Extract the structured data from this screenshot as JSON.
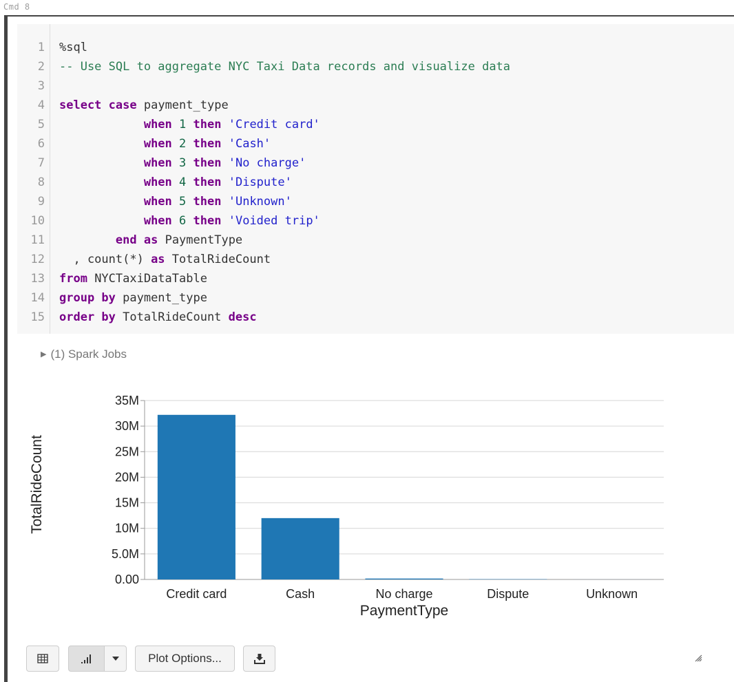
{
  "cell": {
    "cmd_label": "Cmd 8",
    "code_lines": [
      {
        "n": "1",
        "parts": [
          {
            "t": "%sql",
            "c": ""
          }
        ]
      },
      {
        "n": "2",
        "parts": [
          {
            "t": "-- Use SQL to aggregate NYC Taxi Data records and visualize data",
            "c": "cm"
          }
        ]
      },
      {
        "n": "3",
        "parts": []
      },
      {
        "n": "4",
        "parts": [
          {
            "t": "select",
            "c": "kw"
          },
          {
            "t": " ",
            "c": ""
          },
          {
            "t": "case",
            "c": "kw"
          },
          {
            "t": " payment_type",
            "c": ""
          }
        ]
      },
      {
        "n": "5",
        "parts": [
          {
            "t": "            ",
            "c": ""
          },
          {
            "t": "when",
            "c": "kw"
          },
          {
            "t": " ",
            "c": ""
          },
          {
            "t": "1",
            "c": "num"
          },
          {
            "t": " ",
            "c": ""
          },
          {
            "t": "then",
            "c": "kw"
          },
          {
            "t": " ",
            "c": ""
          },
          {
            "t": "'Credit card'",
            "c": "str"
          }
        ]
      },
      {
        "n": "6",
        "parts": [
          {
            "t": "            ",
            "c": ""
          },
          {
            "t": "when",
            "c": "kw"
          },
          {
            "t": " ",
            "c": ""
          },
          {
            "t": "2",
            "c": "num"
          },
          {
            "t": " ",
            "c": ""
          },
          {
            "t": "then",
            "c": "kw"
          },
          {
            "t": " ",
            "c": ""
          },
          {
            "t": "'Cash'",
            "c": "str"
          }
        ]
      },
      {
        "n": "7",
        "parts": [
          {
            "t": "            ",
            "c": ""
          },
          {
            "t": "when",
            "c": "kw"
          },
          {
            "t": " ",
            "c": ""
          },
          {
            "t": "3",
            "c": "num"
          },
          {
            "t": " ",
            "c": ""
          },
          {
            "t": "then",
            "c": "kw"
          },
          {
            "t": " ",
            "c": ""
          },
          {
            "t": "'No charge'",
            "c": "str"
          }
        ]
      },
      {
        "n": "8",
        "parts": [
          {
            "t": "            ",
            "c": ""
          },
          {
            "t": "when",
            "c": "kw"
          },
          {
            "t": " ",
            "c": ""
          },
          {
            "t": "4",
            "c": "num"
          },
          {
            "t": " ",
            "c": ""
          },
          {
            "t": "then",
            "c": "kw"
          },
          {
            "t": " ",
            "c": ""
          },
          {
            "t": "'Dispute'",
            "c": "str"
          }
        ]
      },
      {
        "n": "9",
        "parts": [
          {
            "t": "            ",
            "c": ""
          },
          {
            "t": "when",
            "c": "kw"
          },
          {
            "t": " ",
            "c": ""
          },
          {
            "t": "5",
            "c": "num"
          },
          {
            "t": " ",
            "c": ""
          },
          {
            "t": "then",
            "c": "kw"
          },
          {
            "t": " ",
            "c": ""
          },
          {
            "t": "'Unknown'",
            "c": "str"
          }
        ]
      },
      {
        "n": "10",
        "parts": [
          {
            "t": "            ",
            "c": ""
          },
          {
            "t": "when",
            "c": "kw"
          },
          {
            "t": " ",
            "c": ""
          },
          {
            "t": "6",
            "c": "num"
          },
          {
            "t": " ",
            "c": ""
          },
          {
            "t": "then",
            "c": "kw"
          },
          {
            "t": " ",
            "c": ""
          },
          {
            "t": "'Voided trip'",
            "c": "str"
          }
        ]
      },
      {
        "n": "11",
        "parts": [
          {
            "t": "        ",
            "c": ""
          },
          {
            "t": "end",
            "c": "kw"
          },
          {
            "t": " ",
            "c": ""
          },
          {
            "t": "as",
            "c": "kw"
          },
          {
            "t": " PaymentType",
            "c": ""
          }
        ]
      },
      {
        "n": "12",
        "parts": [
          {
            "t": "  , count(*) ",
            "c": ""
          },
          {
            "t": "as",
            "c": "kw"
          },
          {
            "t": " TotalRideCount",
            "c": ""
          }
        ]
      },
      {
        "n": "13",
        "parts": [
          {
            "t": "from",
            "c": "kw"
          },
          {
            "t": " NYCTaxiDataTable",
            "c": ""
          }
        ]
      },
      {
        "n": "14",
        "parts": [
          {
            "t": "group by",
            "c": "kw"
          },
          {
            "t": " payment_type",
            "c": ""
          }
        ]
      },
      {
        "n": "15",
        "parts": [
          {
            "t": "order by",
            "c": "kw"
          },
          {
            "t": " TotalRideCount ",
            "c": ""
          },
          {
            "t": "desc",
            "c": "kw"
          }
        ]
      }
    ],
    "spark_jobs_label": "(1) Spark Jobs"
  },
  "chart_data": {
    "type": "bar",
    "categories": [
      "Credit card",
      "Cash",
      "No charge",
      "Dispute",
      "Unknown"
    ],
    "values": [
      32200000,
      12000000,
      180000,
      60000,
      5000
    ],
    "xlabel": "PaymentType",
    "ylabel": "TotalRideCount",
    "ylim": [
      0,
      35000000
    ],
    "yticks": [
      0,
      5000000,
      10000000,
      15000000,
      20000000,
      25000000,
      30000000,
      35000000
    ],
    "ytick_labels": [
      "0.00",
      "5.0M",
      "10M",
      "15M",
      "20M",
      "25M",
      "30M",
      "35M"
    ],
    "grid": true,
    "bar_color": "#1f77b4"
  },
  "toolbar": {
    "table_icon": "table-icon",
    "bar_chart_icon": "bar-chart-icon",
    "dropdown_icon": "caret-down-icon",
    "plot_options_label": "Plot Options...",
    "download_icon": "download-icon"
  }
}
